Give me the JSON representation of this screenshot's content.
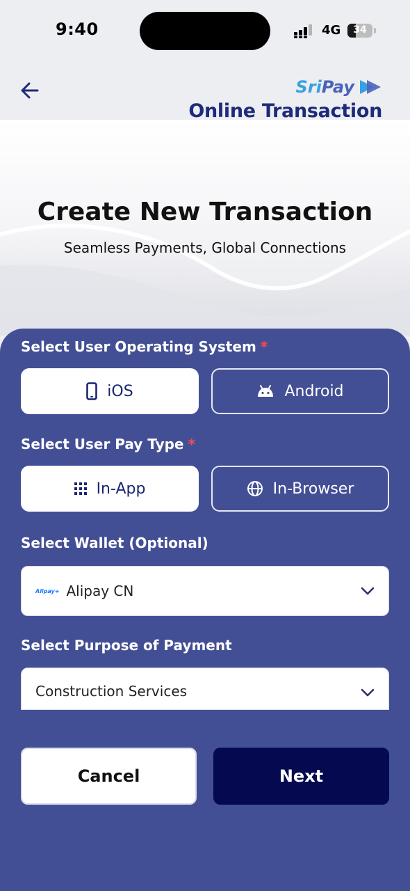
{
  "status_bar": {
    "time": "9:40",
    "network": "4G",
    "battery_level": "34",
    "battery_fraction": 0.34
  },
  "header": {
    "back_icon": "arrow-left-icon",
    "logo": {
      "part1": "Sri",
      "part2": "Pay"
    },
    "title": "Online Transaction"
  },
  "hero": {
    "title": "Create New Transaction",
    "subtitle": "Seamless Payments, Global Connections"
  },
  "form": {
    "os_label": "Select User Operating System",
    "required_mark": "*",
    "os_options": [
      {
        "label": "iOS",
        "icon": "smartphone-icon",
        "selected": true
      },
      {
        "label": "Android",
        "icon": "android-icon",
        "selected": false
      }
    ],
    "pay_type_label": "Select User Pay Type",
    "pay_type_options": [
      {
        "label": "In-App",
        "icon": "grid-icon",
        "selected": true
      },
      {
        "label": "In-Browser",
        "icon": "globe-icon",
        "selected": false
      }
    ],
    "wallet_label": "Select Wallet (Optional)",
    "wallet_logo_text": "Alipay+",
    "wallet_value": "Alipay CN",
    "purpose_label": "Select Purpose of Payment",
    "purpose_value": "Construction Services"
  },
  "actions": {
    "cancel_label": "Cancel",
    "next_label": "Next"
  },
  "colors": {
    "panel": "#434f95",
    "primary_button": "#050a50",
    "title": "#1e2a7a",
    "required": "#ff4a4a"
  }
}
